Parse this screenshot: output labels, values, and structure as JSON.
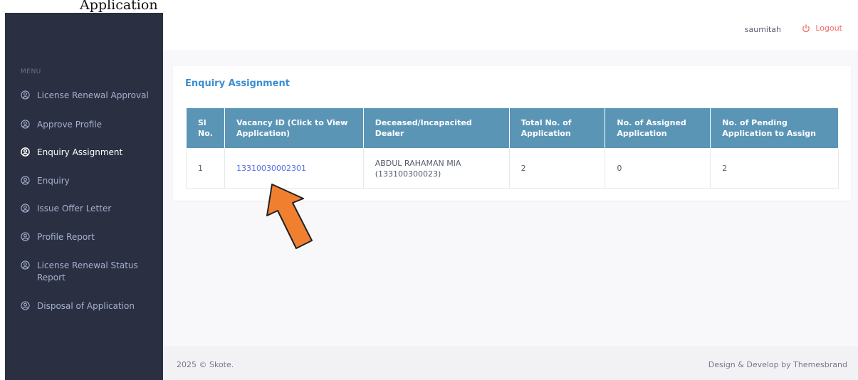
{
  "top_strip": {
    "text": "Application"
  },
  "sidebar": {
    "menu_title": "MENU",
    "items": [
      {
        "label": "License Renewal Approval",
        "icon": "user-circle-icon",
        "active": false
      },
      {
        "label": "Approve Profile",
        "icon": "user-circle-icon",
        "active": false
      },
      {
        "label": "Enquiry Assignment",
        "icon": "user-circle-icon",
        "active": true
      },
      {
        "label": "Enquiry",
        "icon": "user-circle-icon",
        "active": false
      },
      {
        "label": "Issue Offer Letter",
        "icon": "user-circle-icon",
        "active": false
      },
      {
        "label": "Profile Report",
        "icon": "user-circle-icon",
        "active": false
      },
      {
        "label": "License Renewal Status Report",
        "icon": "user-circle-icon",
        "active": false
      },
      {
        "label": "Disposal of Application",
        "icon": "user-circle-icon",
        "active": false
      }
    ]
  },
  "header": {
    "username": "saumitah",
    "logout_label": "Logout"
  },
  "card": {
    "title": "Enquiry Assignment",
    "columns": [
      "Sl No.",
      "Vacancy ID (Click to View Application)",
      "Deceased/Incapacited Dealer",
      "Total No. of Application",
      "No. of Assigned Application",
      "No. of Pending Application to Assign"
    ],
    "rows": [
      [
        "1",
        "13310030002301",
        "ABDUL RAHAMAN MIA (133100300023)",
        "2",
        "0",
        "2"
      ]
    ]
  },
  "footer": {
    "left": "2025 © Skote.",
    "right": "Design & Develop by Themesbrand"
  },
  "colors": {
    "sidebar_bg": "#2a3042",
    "table_header_bg": "#5b95b6",
    "title_blue": "#3b8fd1",
    "link": "#556ee6",
    "logout_red": "#f46a6a",
    "arrow_orange": "#f08030"
  }
}
